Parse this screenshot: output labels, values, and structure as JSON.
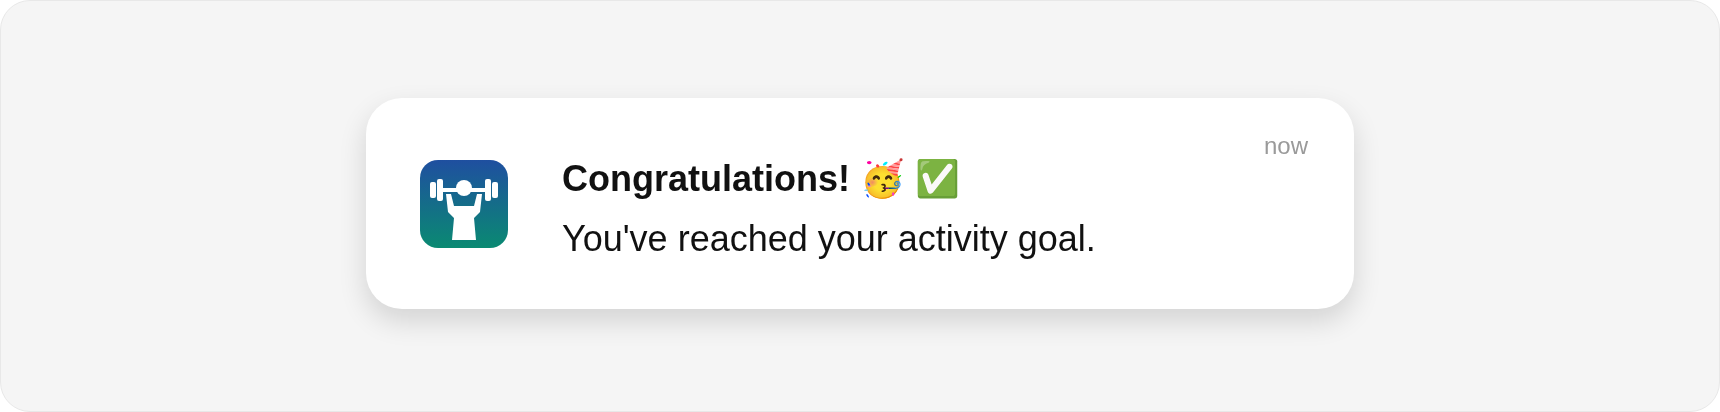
{
  "notification": {
    "title": "Congratulations! 🥳 ✅",
    "message": "You've reached your activity goal.",
    "time": "now"
  }
}
